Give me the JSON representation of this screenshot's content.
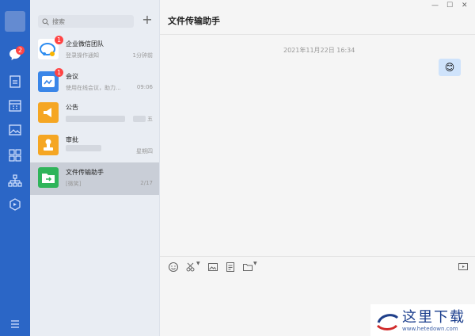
{
  "sidebar": {
    "chat_badge": "2"
  },
  "list": {
    "search_placeholder": "搜索",
    "items": [
      {
        "title": "企业微信团队",
        "sub": "登录操作通知",
        "time": "1分钟前",
        "badge": "1"
      },
      {
        "title": "会议",
        "sub": "使用在线会议，助力...",
        "time": "09:06",
        "badge": "1"
      },
      {
        "title": "公告",
        "sub": "",
        "time": "五",
        "badge": ""
      },
      {
        "title": "审批",
        "sub": "",
        "time": "星期四",
        "badge": ""
      },
      {
        "title": "文件传输助手",
        "sub": "[微笑]",
        "time": "2/17",
        "badge": ""
      }
    ]
  },
  "main": {
    "title": "文件传输助手",
    "date": "2021年11月22日 16:34",
    "bubble": "😊"
  },
  "colors": {
    "sidebar": "#2b66c6",
    "list_bg": "#e9edf3",
    "selected": "#c9ced7",
    "bubble": "#cfe3fb",
    "badge": "#ff4444"
  },
  "watermark": {
    "text": "这里下载",
    "url": "www.hetedown.com"
  }
}
